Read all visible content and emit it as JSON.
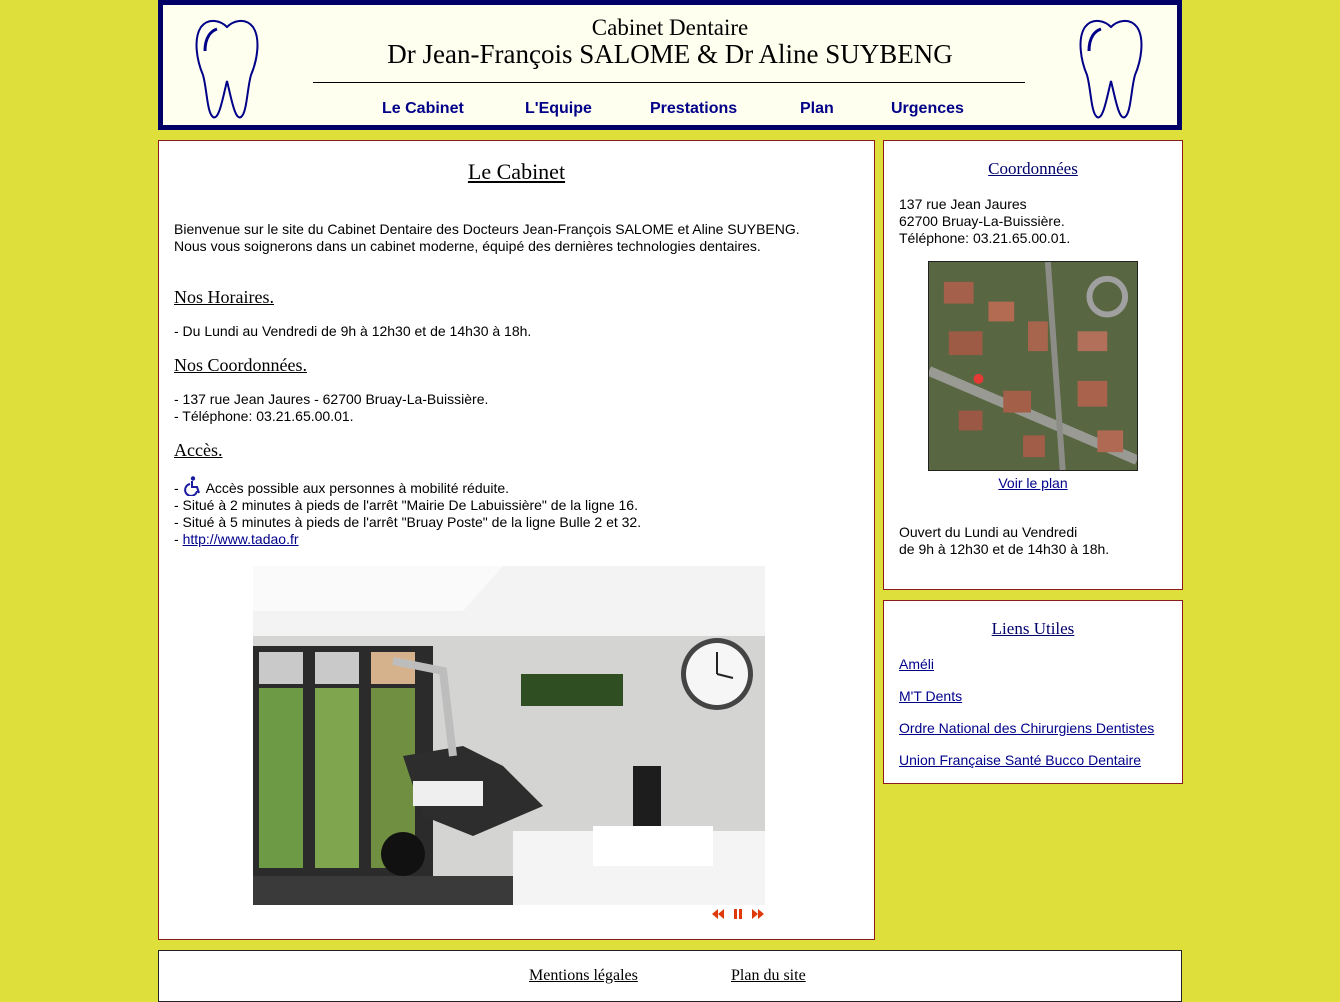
{
  "header": {
    "subtitle": "Cabinet Dentaire",
    "title": "Dr Jean-François SALOME & Dr Aline SUYBENG",
    "nav": [
      {
        "label": "Le Cabinet"
      },
      {
        "label": "L'Equipe"
      },
      {
        "label": "Prestations"
      },
      {
        "label": "Plan"
      },
      {
        "label": "Urgences"
      }
    ]
  },
  "main": {
    "title": "Le Cabinet",
    "intro_1": "Bienvenue sur le site du Cabinet Dentaire des Docteurs Jean-François SALOME et Aline SUYBENG.",
    "intro_2": "Nous vous soignerons dans un cabinet moderne, équipé des dernières technologies dentaires.",
    "hours_heading": "Nos Horaires.",
    "hours_text": "- Du Lundi au Vendredi de 9h à 12h30 et de 14h30 à 18h.",
    "coords_heading": "Nos Coordonnées.",
    "coords_line_1": "- 137 rue Jean Jaures - 62700 Bruay-La-Buissière.",
    "coords_line_2": "- Téléphone: 03.21.65.00.01.",
    "access_heading": "Accès.",
    "access_line_1": "- ",
    "access_line_1b": "Accès possible aux personnes à mobilité réduite.",
    "access_line_2": "- Situé à 2 minutes à pieds de l'arrêt \"Mairie De Labuissière\" de la ligne 16.",
    "access_line_3": "- Situé à 5 minutes à pieds de l'arrêt \"Bruay Poste\" de la ligne Bulle 2 et 32.",
    "access_line_4_prefix": "- ",
    "access_link": "http://www.tadao.fr"
  },
  "sidebar": {
    "coords_title": "Coordonnées",
    "address_1": "137 rue Jean Jaures",
    "address_2": "62700 Bruay-La-Buissière.",
    "phone": "Téléphone: 03.21.65.00.01.",
    "map_link": "Voir le plan",
    "open_1": "Ouvert du Lundi au Vendredi",
    "open_2": "de 9h à 12h30 et de 14h30 à 18h.",
    "links_title": "Liens Utiles",
    "links": [
      {
        "label": "Améli"
      },
      {
        "label": "M'T Dents"
      },
      {
        "label": "Ordre National des Chirurgiens Dentistes"
      },
      {
        "label": "Union Française Santé Bucco Dentaire"
      }
    ]
  },
  "footer": {
    "legal": "Mentions légales",
    "sitemap": "Plan du site"
  },
  "colors": {
    "page_bg": "#dfdf3c",
    "header_border": "#000066",
    "nav_text": "#000088",
    "panel_border": "#8b1a1a"
  }
}
